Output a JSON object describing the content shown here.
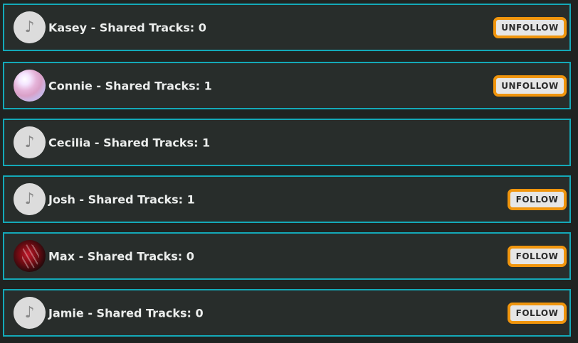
{
  "users": [
    {
      "label": "Kasey - Shared Tracks: 0",
      "avatar_icon": "music-note-icon",
      "button": "UNFOLLOW"
    },
    {
      "label": "Connie - Shared Tracks: 1",
      "avatar_icon": "photo",
      "button": "UNFOLLOW"
    },
    {
      "label": "Cecilia - Shared Tracks: 1",
      "avatar_icon": "music-note-icon",
      "button": ""
    },
    {
      "label": "Josh - Shared Tracks: 1",
      "avatar_icon": "music-note-icon",
      "button": "FOLLOW"
    },
    {
      "label": "Max - Shared Tracks: 0",
      "avatar_icon": "photo",
      "button": "FOLLOW"
    },
    {
      "label": "Jamie - Shared Tracks: 0",
      "avatar_icon": "music-note-icon",
      "button": "FOLLOW"
    }
  ],
  "colors": {
    "row_border": "#14a9b8",
    "row_background": "#282d2b",
    "button_border": "#f0950d"
  }
}
